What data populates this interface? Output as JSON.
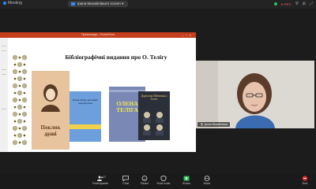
{
  "window": {
    "title": "Meeting",
    "share_label": "Іринa Михайлівна's screen",
    "recording_label": "REC"
  },
  "presentation": {
    "app_title": "Презентація – PowerPoint",
    "slide_title": "Бібліографічні видання про О. Телігу",
    "books": [
      {
        "title": "Поклик душі",
        "subtitle": "Олена Теліга"
      },
      {
        "title": "Олена Теліга: життєвий і творчий шлях"
      },
      {
        "title": "ОЛЕНА ТЕЛІГА"
      },
      {
        "title": "Дорогами Шевченка і Телігі"
      }
    ]
  },
  "participant": {
    "name": "Іринa Михайлівна"
  },
  "toolbar": {
    "participants_count": "17",
    "items": [
      {
        "label": "Participants"
      },
      {
        "label": "Chat"
      },
      {
        "label": "React"
      },
      {
        "label": "Host tools"
      },
      {
        "label": "Share"
      },
      {
        "label": "More"
      },
      {
        "label": "End"
      }
    ]
  },
  "colors": {
    "powerpoint_red": "#c43e1c",
    "end_red": "#e02828",
    "accent_blue": "#2d8cff"
  }
}
